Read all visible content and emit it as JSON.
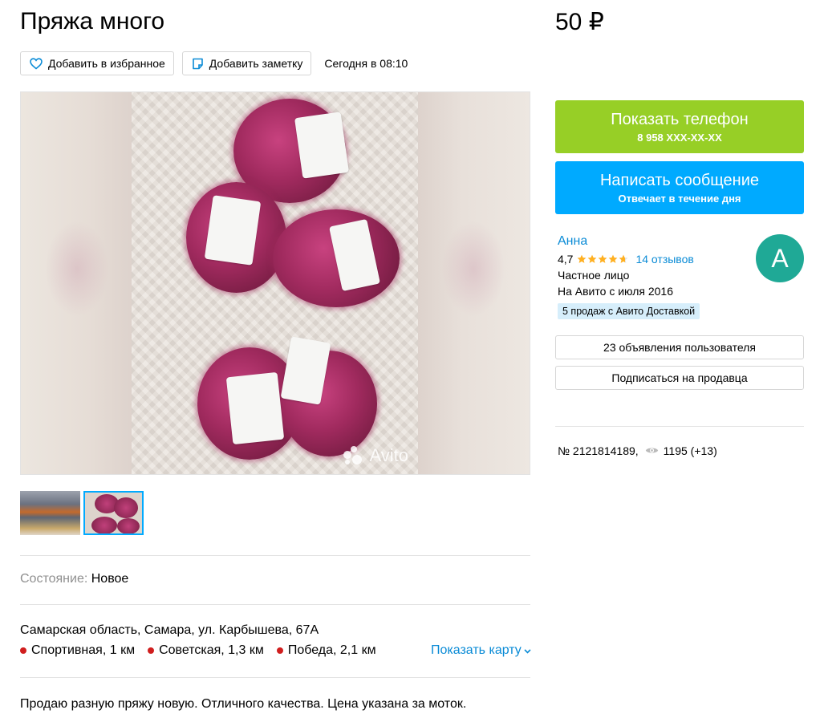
{
  "listing": {
    "title": "Пряжа много",
    "price": "50 ₽"
  },
  "actions": {
    "favorite_label": "Добавить в избранное",
    "note_label": "Добавить заметку",
    "date": "Сегодня в 08:10"
  },
  "gallery": {
    "watermark": "Avito",
    "thumbnail_count": 2,
    "active_thumbnail": 2
  },
  "params": {
    "condition_label": "Состояние:",
    "condition_value": "Новое"
  },
  "location": {
    "address": "Самарская область, Самара, ул. Карбышева, 67А",
    "metro": [
      {
        "name": "Спортивная, 1 км"
      },
      {
        "name": "Советская, 1,3 км"
      },
      {
        "name": "Победа, 2,1 км"
      }
    ],
    "map_link": "Показать карту"
  },
  "description": "Продаю разную пряжу новую. Отличного качества. Цена указана за моток.",
  "contact": {
    "phone_label": "Показать телефон",
    "phone_masked": "8 958 XXX-XX-XX",
    "message_label": "Написать сообщение",
    "message_sub": "Отвечает в течение дня"
  },
  "seller": {
    "name": "Анна",
    "rating": "4,7",
    "rating_value": 4.7,
    "reviews": "14 отзывов",
    "type": "Частное лицо",
    "since": "На Авито с июля 2016",
    "badge": "5 продаж с Авито Доставкой",
    "avatar_letter": "А",
    "ads_button": "23 объявления пользователя",
    "subscribe_button": "Подписаться на продавца"
  },
  "meta": {
    "ad_number": "№ 2121814189,",
    "views": "1195 (+13)"
  },
  "colors": {
    "phone_button": "#97cf26",
    "message_button": "#00aaff",
    "link": "#0a8bd6",
    "avatar": "#1fa996",
    "metro_dot": "#d01e1e",
    "star": "#ffb021"
  }
}
